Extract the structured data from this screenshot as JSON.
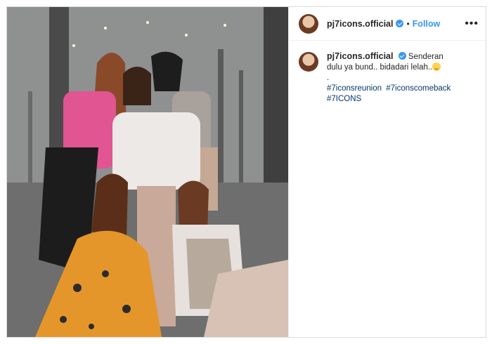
{
  "post": {
    "username": "pj7icons.official",
    "follow_label": "Follow",
    "more_icon": "more-horizontal-icon",
    "caption": {
      "text": "Senderan dulu ya bund.. bidadari lelah..",
      "separator": ".",
      "hashtags": [
        "#7iconsreunion",
        "#7iconscomeback",
        "#7ICONS"
      ]
    }
  },
  "colors": {
    "accent": "#3897f0",
    "hashtag": "#00376b",
    "text": "#262626",
    "border": "#dbdbdb"
  }
}
